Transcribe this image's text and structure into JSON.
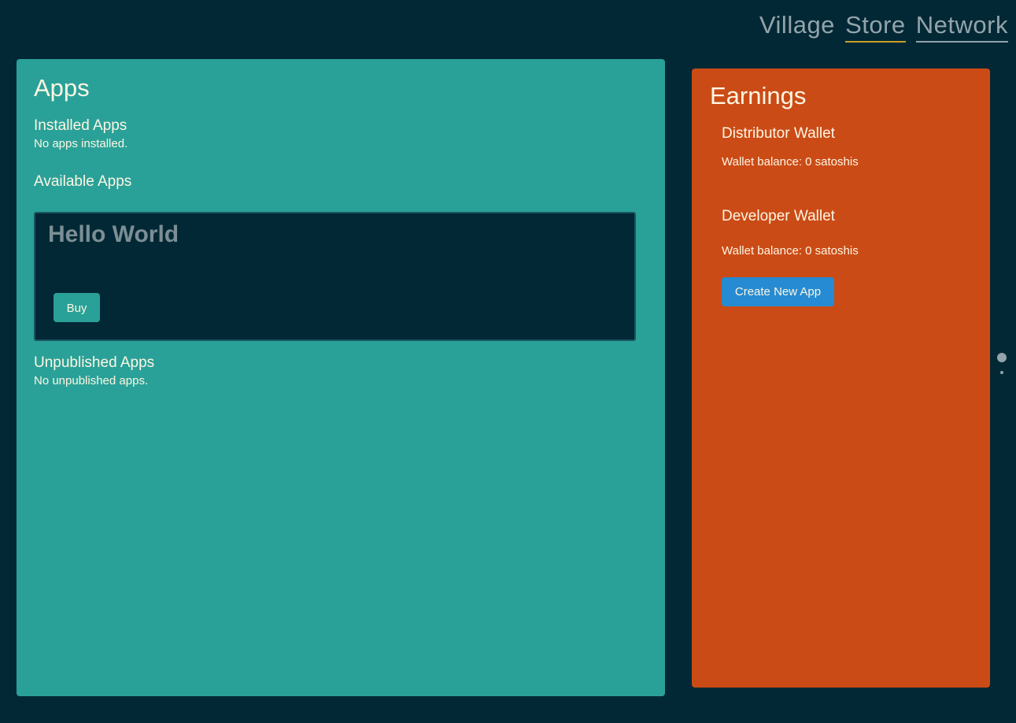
{
  "brand": {
    "word1": "Village",
    "word2": "Store",
    "word3": "Network"
  },
  "apps": {
    "title": "Apps",
    "installed_title": "Installed Apps",
    "installed_empty": "No apps installed.",
    "available_title": "Available Apps",
    "available": [
      {
        "name": "Hello World",
        "buy_label": "Buy"
      }
    ],
    "unpublished_title": "Unpublished Apps",
    "unpublished_empty": "No unpublished apps."
  },
  "earnings": {
    "title": "Earnings",
    "distributor": {
      "title": "Distributor Wallet",
      "balance": "Wallet balance: 0 satoshis"
    },
    "developer": {
      "title": "Developer Wallet",
      "balance": "Wallet balance: 0 satoshis"
    },
    "create_label": "Create New App"
  },
  "colors": {
    "background": "#022835",
    "apps_panel": "#2aa198",
    "earnings_panel": "#cb4b16",
    "create_button": "#268bd2",
    "accent_underline": "#c9a227"
  }
}
